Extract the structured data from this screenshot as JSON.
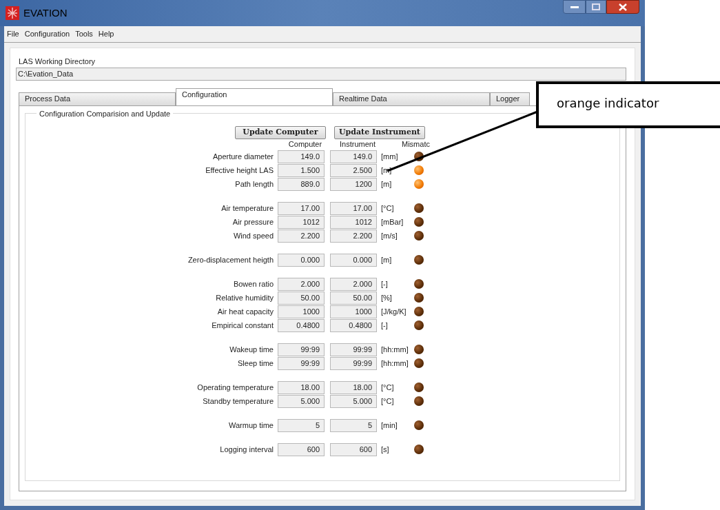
{
  "window": {
    "title": "EVATION"
  },
  "menu": [
    "File",
    "Configuration",
    "Tools",
    "Help"
  ],
  "working_directory": {
    "label": "LAS Working Directory",
    "value": "C:\\Evation_Data"
  },
  "tabs": [
    {
      "label": "Process Data",
      "selected": false
    },
    {
      "label": "Configuration",
      "selected": true
    },
    {
      "label": "Realtime Data",
      "selected": false
    },
    {
      "label": "Logger",
      "selected": false
    }
  ],
  "group_title": "Configuration Comparision and Update",
  "buttons": [
    "Update Computer",
    "Update Instrument"
  ],
  "columns": [
    "Computer",
    "Instrument",
    "Mismatc"
  ],
  "groups": [
    {
      "rows": [
        {
          "label": "Aperture diameter",
          "computer": "149.0",
          "instrument": "149.0",
          "unit": "[mm]",
          "mismatch": false
        },
        {
          "label": "Effective height LAS",
          "computer": "1.500",
          "instrument": "2.500",
          "unit": "[m]",
          "mismatch": true
        },
        {
          "label": "Path length",
          "computer": "889.0",
          "instrument": "1200",
          "unit": "[m]",
          "mismatch": true
        }
      ]
    },
    {
      "rows": [
        {
          "label": "Air temperature",
          "computer": "17.00",
          "instrument": "17.00",
          "unit": "[°C]",
          "mismatch": false
        },
        {
          "label": "Air pressure",
          "computer": "1012",
          "instrument": "1012",
          "unit": "[mBar]",
          "mismatch": false
        },
        {
          "label": "Wind speed",
          "computer": "2.200",
          "instrument": "2.200",
          "unit": "[m/s]",
          "mismatch": false
        }
      ]
    },
    {
      "rows": [
        {
          "label": "Zero-displacement heigth",
          "computer": "0.000",
          "instrument": "0.000",
          "unit": "[m]",
          "mismatch": false
        }
      ]
    },
    {
      "rows": [
        {
          "label": "Bowen ratio",
          "computer": "2.000",
          "instrument": "2.000",
          "unit": "[-]",
          "mismatch": false
        },
        {
          "label": "Relative humidity",
          "computer": "50.00",
          "instrument": "50.00",
          "unit": "[%]",
          "mismatch": false
        },
        {
          "label": "Air heat capacity",
          "computer": "1000",
          "instrument": "1000",
          "unit": "[J/kg/K]",
          "mismatch": false
        },
        {
          "label": "Empirical constant",
          "computer": "0.4800",
          "instrument": "0.4800",
          "unit": "[-]",
          "mismatch": false
        }
      ]
    },
    {
      "rows": [
        {
          "label": "Wakeup time",
          "computer": "99:99",
          "instrument": "99:99",
          "unit": "[hh:mm]",
          "mismatch": false
        },
        {
          "label": "Sleep time",
          "computer": "99:99",
          "instrument": "99:99",
          "unit": "[hh:mm]",
          "mismatch": false
        }
      ]
    },
    {
      "rows": [
        {
          "label": "Operating temperature",
          "computer": "18.00",
          "instrument": "18.00",
          "unit": "[°C]",
          "mismatch": false
        },
        {
          "label": "Standby temperature",
          "computer": "5.000",
          "instrument": "5.000",
          "unit": "[°C]",
          "mismatch": false
        }
      ]
    },
    {
      "rows": [
        {
          "label": "Warmup time",
          "computer": "5",
          "instrument": "5",
          "unit": "[min]",
          "mismatch": false
        }
      ]
    },
    {
      "rows": [
        {
          "label": "Logging interval",
          "computer": "600",
          "instrument": "600",
          "unit": "[s]",
          "mismatch": false
        }
      ]
    }
  ],
  "annotation": {
    "text": "orange indicator"
  }
}
